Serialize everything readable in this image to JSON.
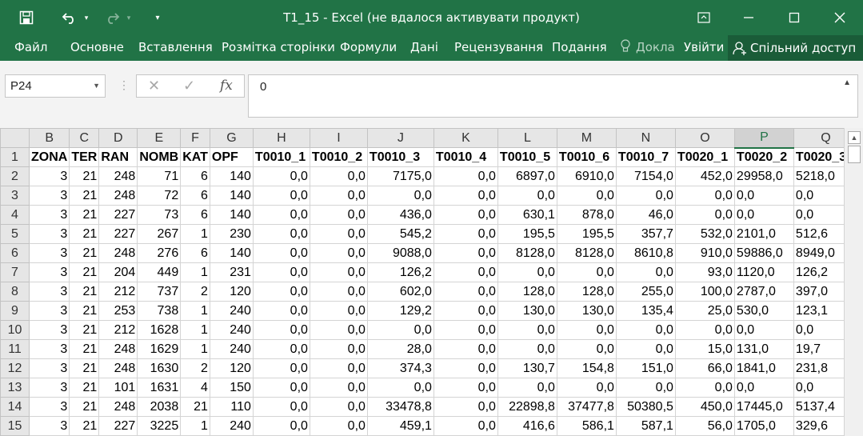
{
  "window": {
    "title": "T1_15 - Excel (не вдалося активувати продукт)",
    "save_icon": "save-icon",
    "undo_icon": "undo-icon",
    "redo_icon": "redo-icon",
    "customize_icon": "customize-qat-icon",
    "ribbon_display_icon": "ribbon-display-icon",
    "minimize_icon": "minimize-icon",
    "restore_icon": "restore-icon",
    "close_icon": "close-icon"
  },
  "ribbon": {
    "tabs": [
      "Файл",
      "Основне",
      "Вставлення",
      "Розмітка сторінки",
      "Формули",
      "Дані",
      "Рецензування",
      "Подання"
    ],
    "tell_me": "Доклад",
    "sign_in": "Увійти",
    "share": "Спільний доступ"
  },
  "formula_bar": {
    "name_box": "P24",
    "cancel": "✕",
    "enter": "✓",
    "fx": "fx",
    "value": "0"
  },
  "sheet": {
    "columns": [
      "B",
      "C",
      "D",
      "E",
      "F",
      "G",
      "H",
      "I",
      "J",
      "K",
      "L",
      "M",
      "N",
      "O",
      "P",
      "Q"
    ],
    "selected_column": "P",
    "rows": [
      {
        "n": "1",
        "cells": [
          "ZONA",
          "TER",
          "RAN",
          "NOMB",
          "KAT",
          "OPF",
          "T0010_1",
          "T0010_2",
          "T0010_3",
          "T0010_4",
          "T0010_5",
          "T0010_6",
          "T0010_7",
          "T0020_1",
          "T0020_2",
          "T0020_3"
        ]
      },
      {
        "n": "2",
        "cells": [
          "3",
          "21",
          "248",
          "71",
          "6",
          "140",
          "0,0",
          "0,0",
          "7175,0",
          "0,0",
          "6897,0",
          "6910,0",
          "7154,0",
          "452,0",
          "29958,0",
          "5218,0"
        ]
      },
      {
        "n": "3",
        "cells": [
          "3",
          "21",
          "248",
          "72",
          "6",
          "140",
          "0,0",
          "0,0",
          "0,0",
          "0,0",
          "0,0",
          "0,0",
          "0,0",
          "0,0",
          "0,0",
          "0,0"
        ]
      },
      {
        "n": "4",
        "cells": [
          "3",
          "21",
          "227",
          "73",
          "6",
          "140",
          "0,0",
          "0,0",
          "436,0",
          "0,0",
          "630,1",
          "878,0",
          "46,0",
          "0,0",
          "0,0",
          "0,0"
        ]
      },
      {
        "n": "5",
        "cells": [
          "3",
          "21",
          "227",
          "267",
          "1",
          "230",
          "0,0",
          "0,0",
          "545,2",
          "0,0",
          "195,5",
          "195,5",
          "357,7",
          "532,0",
          "2101,0",
          "512,6"
        ]
      },
      {
        "n": "6",
        "cells": [
          "3",
          "21",
          "248",
          "276",
          "6",
          "140",
          "0,0",
          "0,0",
          "9088,0",
          "0,0",
          "8128,0",
          "8128,0",
          "8610,8",
          "910,0",
          "59886,0",
          "8949,0"
        ]
      },
      {
        "n": "7",
        "cells": [
          "3",
          "21",
          "204",
          "449",
          "1",
          "231",
          "0,0",
          "0,0",
          "126,2",
          "0,0",
          "0,0",
          "0,0",
          "0,0",
          "93,0",
          "1120,0",
          "126,2"
        ]
      },
      {
        "n": "8",
        "cells": [
          "3",
          "21",
          "212",
          "737",
          "2",
          "120",
          "0,0",
          "0,0",
          "602,0",
          "0,0",
          "128,0",
          "128,0",
          "255,0",
          "100,0",
          "2787,0",
          "397,0"
        ]
      },
      {
        "n": "9",
        "cells": [
          "3",
          "21",
          "253",
          "738",
          "1",
          "240",
          "0,0",
          "0,0",
          "129,2",
          "0,0",
          "130,0",
          "130,0",
          "135,4",
          "25,0",
          "530,0",
          "123,1"
        ]
      },
      {
        "n": "10",
        "cells": [
          "3",
          "21",
          "212",
          "1628",
          "1",
          "240",
          "0,0",
          "0,0",
          "0,0",
          "0,0",
          "0,0",
          "0,0",
          "0,0",
          "0,0",
          "0,0",
          "0,0"
        ]
      },
      {
        "n": "11",
        "cells": [
          "3",
          "21",
          "248",
          "1629",
          "1",
          "240",
          "0,0",
          "0,0",
          "28,0",
          "0,0",
          "0,0",
          "0,0",
          "0,0",
          "15,0",
          "131,0",
          "19,7"
        ]
      },
      {
        "n": "12",
        "cells": [
          "3",
          "21",
          "248",
          "1630",
          "2",
          "120",
          "0,0",
          "0,0",
          "374,3",
          "0,0",
          "130,7",
          "154,8",
          "151,0",
          "66,0",
          "1841,0",
          "231,8"
        ]
      },
      {
        "n": "13",
        "cells": [
          "3",
          "21",
          "101",
          "1631",
          "4",
          "150",
          "0,0",
          "0,0",
          "0,0",
          "0,0",
          "0,0",
          "0,0",
          "0,0",
          "0,0",
          "0,0",
          "0,0"
        ]
      },
      {
        "n": "14",
        "cells": [
          "3",
          "21",
          "248",
          "2038",
          "21",
          "110",
          "0,0",
          "0,0",
          "33478,8",
          "0,0",
          "22898,8",
          "37477,8",
          "50380,5",
          "450,0",
          "17445,0",
          "5137,4"
        ]
      },
      {
        "n": "15",
        "cells": [
          "3",
          "21",
          "227",
          "3225",
          "1",
          "240",
          "0,0",
          "0,0",
          "459,1",
          "0,0",
          "416,6",
          "586,1",
          "587,1",
          "56,0",
          "1705,0",
          "329,6"
        ]
      }
    ]
  }
}
